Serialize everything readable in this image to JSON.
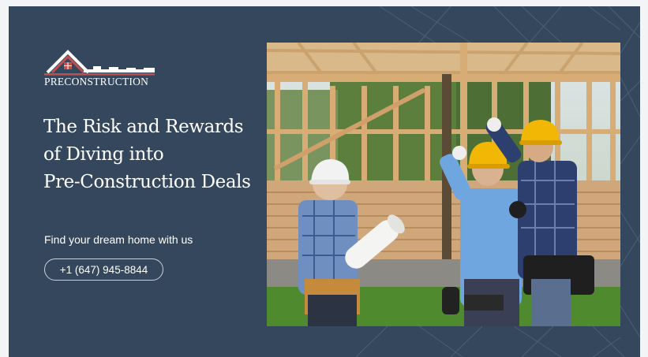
{
  "logo": {
    "text": "PRECONSTRUCTION",
    "icon": "house-roofline-logo",
    "colors": {
      "roof": "#c0504d",
      "white": "#ffffff"
    }
  },
  "hero": {
    "headline_lines": [
      "The Risk and Rewards",
      "of Diving into",
      "Pre-Construction Deals"
    ],
    "tagline": "Find your dream home with us",
    "phone_label": "+1 (647) 945-8844"
  },
  "photo": {
    "subject": "construction-workers-wood-frame-photo"
  },
  "colors": {
    "background": "#34475c",
    "page": "#f3f4f6",
    "hardhat_white": "#f2f2f2",
    "hardhat_yellow": "#f2b705"
  }
}
